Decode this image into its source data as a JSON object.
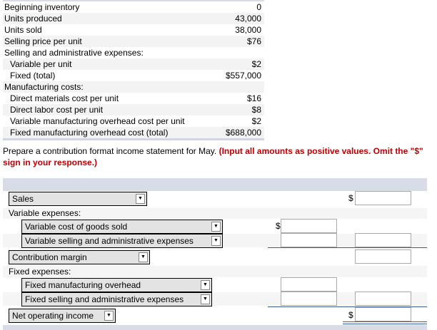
{
  "given": [
    {
      "label": "Beginning inventory",
      "value": "0",
      "indent": false
    },
    {
      "label": "Units produced",
      "value": "43,000",
      "indent": false
    },
    {
      "label": "Units sold",
      "value": "38,000",
      "indent": false
    },
    {
      "label": "Selling price per unit",
      "value": "$76",
      "indent": false
    },
    {
      "label": "Selling and administrative expenses:",
      "value": "",
      "indent": false
    },
    {
      "label": "Variable per unit",
      "value": "$2",
      "indent": true
    },
    {
      "label": "Fixed (total)",
      "value": "$557,000",
      "indent": true
    },
    {
      "label": "Manufacturing costs:",
      "value": "",
      "indent": false
    },
    {
      "label": "Direct materials cost per unit",
      "value": "$16",
      "indent": true
    },
    {
      "label": "Direct labor cost per unit",
      "value": "$8",
      "indent": true
    },
    {
      "label": "Variable manufacturing overhead cost per unit",
      "value": "$2",
      "indent": true
    },
    {
      "label": "Fixed manufacturing overhead cost (total)",
      "value": "$688,000",
      "indent": true
    }
  ],
  "instructions": {
    "text": "Prepare a contribution format income statement for May.",
    "note": "(Input all amounts as positive values. Omit the \"$\" sign in your response.)"
  },
  "statement": {
    "sales": "Sales",
    "variable_label": "Variable expenses:",
    "vcgs": "Variable cost of goods sold",
    "vsa": "Variable selling and administrative expenses",
    "cm": "Contribution margin",
    "fixed_label": "Fixed expenses:",
    "fmo": "Fixed manufacturing overhead",
    "fsa": "Fixed selling and administrative expenses",
    "noi": "Net operating income",
    "dollar": "$",
    "arrow": "▼"
  }
}
